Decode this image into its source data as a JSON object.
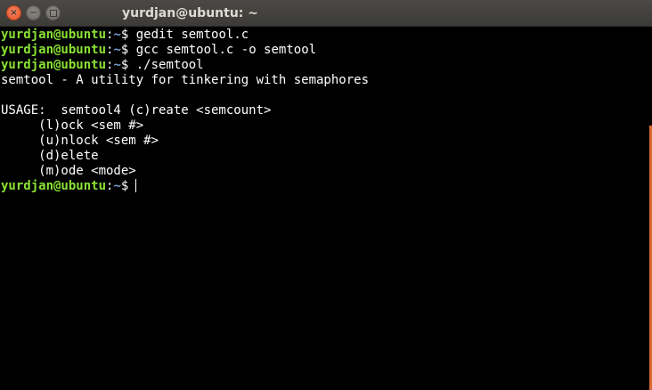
{
  "window": {
    "title": "yurdjan@ubuntu: ~",
    "close_glyph": "×",
    "minimize_glyph": "−"
  },
  "terminal": {
    "lines": [
      {
        "type": "prompt",
        "user": "yurdjan@ubuntu",
        "colon": ":",
        "path": "~",
        "symbol": "$",
        "command": " gedit semtool.c"
      },
      {
        "type": "prompt",
        "user": "yurdjan@ubuntu",
        "colon": ":",
        "path": "~",
        "symbol": "$",
        "command": " gcc semtool.c -o semtool"
      },
      {
        "type": "prompt",
        "user": "yurdjan@ubuntu",
        "colon": ":",
        "path": "~",
        "symbol": "$",
        "command": " ./semtool"
      },
      {
        "type": "output",
        "text": "semtool - A utility for tinkering with semaphores"
      },
      {
        "type": "output",
        "text": ""
      },
      {
        "type": "output",
        "text": "USAGE:  semtool4 (c)reate <semcount>"
      },
      {
        "type": "output",
        "text": "     (l)ock <sem #>"
      },
      {
        "type": "output",
        "text": "     (u)nlock <sem #>"
      },
      {
        "type": "output",
        "text": "     (d)elete"
      },
      {
        "type": "output",
        "text": "     (m)ode <mode>"
      },
      {
        "type": "prompt",
        "user": "yurdjan@ubuntu",
        "colon": ":",
        "path": "~",
        "symbol": "$",
        "command": ""
      }
    ]
  },
  "colors": {
    "background": "#000000",
    "prompt_user": "#8ae234",
    "prompt_path": "#729fcf",
    "text": "#ffffff",
    "titlebar": "#3c3b37",
    "close_button": "#e45324"
  }
}
